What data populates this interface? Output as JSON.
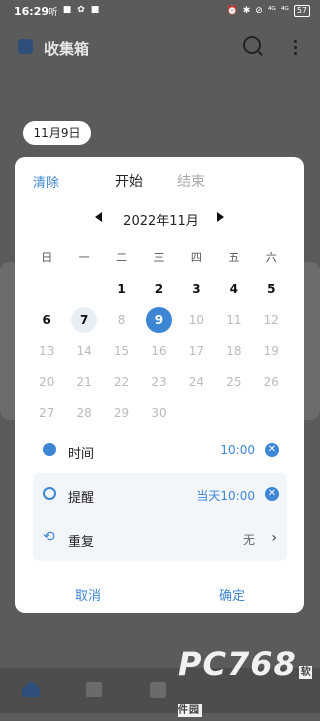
{
  "status_bar": {
    "time": "16:29",
    "left_icons": [
      "听",
      "■",
      "✿",
      "■"
    ],
    "right_icons": [
      "⏰",
      "✱",
      "⊘",
      "⁴ᴳ",
      "⁴ᴳ"
    ],
    "battery": "57"
  },
  "appbar": {
    "title": "收集箱"
  },
  "date_chip": "11月9日",
  "dialog": {
    "clear_label": "清除",
    "tab_start": "开始",
    "tab_end": "结束",
    "month_label": "2022年11月",
    "weekdays": [
      "日",
      "一",
      "二",
      "三",
      "四",
      "五",
      "六"
    ],
    "days": [
      {
        "n": "",
        "s": "empty"
      },
      {
        "n": "",
        "s": "empty"
      },
      {
        "n": "1",
        "s": "active"
      },
      {
        "n": "2",
        "s": "active"
      },
      {
        "n": "3",
        "s": "active"
      },
      {
        "n": "4",
        "s": "active"
      },
      {
        "n": "5",
        "s": "active"
      },
      {
        "n": "6",
        "s": "active"
      },
      {
        "n": "7",
        "s": "today"
      },
      {
        "n": "8",
        "s": "past"
      },
      {
        "n": "9",
        "s": "selected"
      },
      {
        "n": "10",
        "s": "past"
      },
      {
        "n": "11",
        "s": "past"
      },
      {
        "n": "12",
        "s": "past"
      },
      {
        "n": "13",
        "s": "past"
      },
      {
        "n": "14",
        "s": "past"
      },
      {
        "n": "15",
        "s": "past"
      },
      {
        "n": "16",
        "s": "past"
      },
      {
        "n": "17",
        "s": "past"
      },
      {
        "n": "18",
        "s": "past"
      },
      {
        "n": "19",
        "s": "past"
      },
      {
        "n": "20",
        "s": "past"
      },
      {
        "n": "21",
        "s": "past"
      },
      {
        "n": "22",
        "s": "past"
      },
      {
        "n": "23",
        "s": "past"
      },
      {
        "n": "24",
        "s": "past"
      },
      {
        "n": "25",
        "s": "past"
      },
      {
        "n": "26",
        "s": "past"
      },
      {
        "n": "27",
        "s": "past"
      },
      {
        "n": "28",
        "s": "past"
      },
      {
        "n": "29",
        "s": "past"
      },
      {
        "n": "30",
        "s": "past"
      }
    ],
    "time_label": "时间",
    "time_value": "10:00",
    "reminder_label": "提醒",
    "reminder_value": "当天10:00",
    "repeat_label": "重复",
    "repeat_value": "无",
    "cancel_label": "取消",
    "confirm_label": "确定"
  },
  "watermark": "PC768",
  "watermark_sub": "软件园",
  "colors": {
    "accent": "#3d86d6",
    "overlay": "#5b5b5b"
  }
}
